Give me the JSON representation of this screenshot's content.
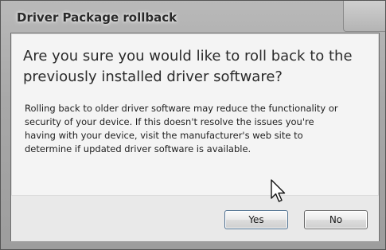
{
  "dialog": {
    "title": "Driver Package rollback",
    "main_instruction": "Are you sure you would like to roll back to the previously installed driver software?",
    "content_text": "Rolling back to older driver software may reduce the functionality or security of your device. If this doesn't resolve the issues you're having with your device, visit the manufacturer's web site to determine if updated driver software is available.",
    "buttons": {
      "yes_label": "Yes",
      "no_label": "No"
    }
  },
  "cursor": {
    "icon": "arrow-pointer-icon"
  }
}
